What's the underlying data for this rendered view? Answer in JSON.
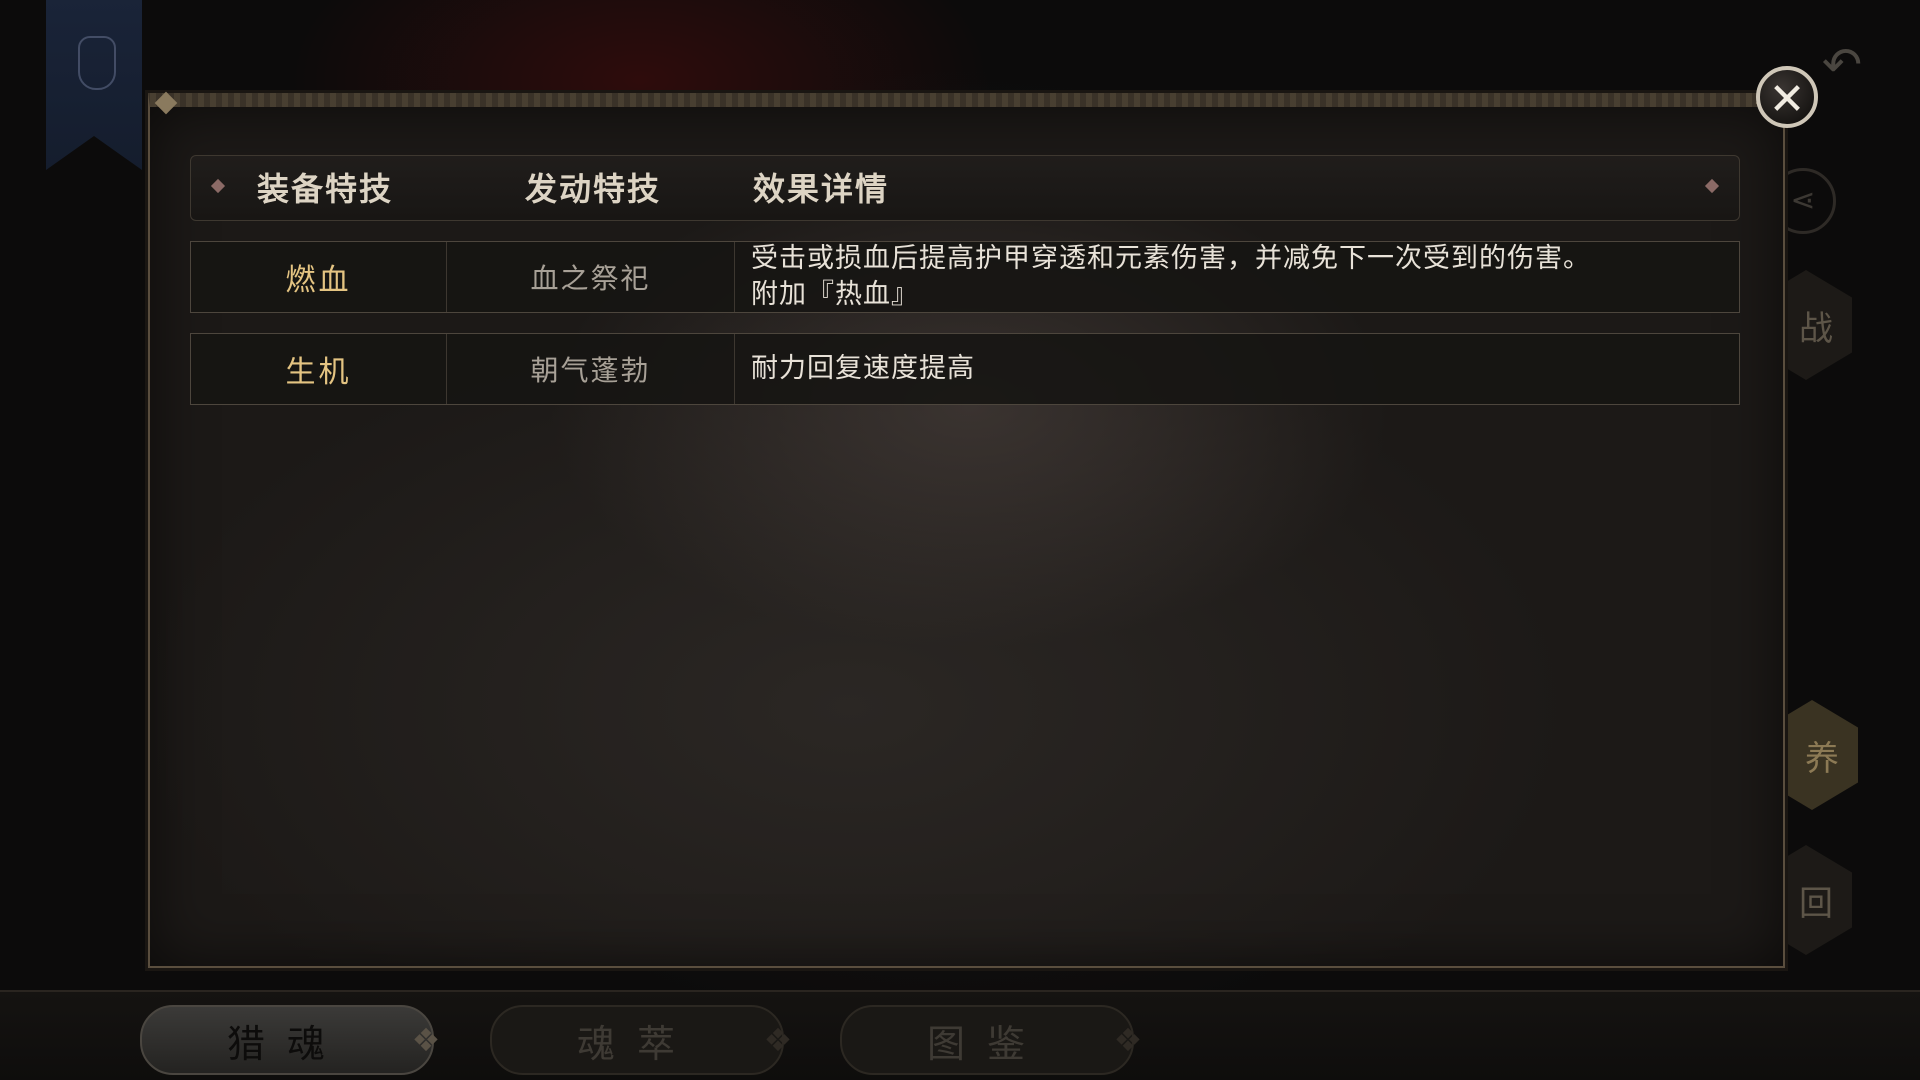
{
  "background": {
    "side_buttons": [
      "战",
      "养",
      "回"
    ],
    "bottom_tabs": [
      {
        "label": "猎魂",
        "active": true
      },
      {
        "label": "魂萃",
        "active": false
      },
      {
        "label": "图鉴",
        "active": false
      }
    ]
  },
  "dialog": {
    "close_icon": "close-icon",
    "headers": {
      "trait": "装备特技",
      "trigger": "发动特技",
      "effect": "效果详情"
    },
    "rows": [
      {
        "trait": "燃血",
        "trigger": "血之祭祀",
        "effect_line1": "受击或损血后提高护甲穿透和元素伤害，并减免下一次受到的伤害。",
        "effect_line2": "附加『热血』"
      },
      {
        "trait": "生机",
        "trigger": "朝气蓬勃",
        "effect_line1": "耐力回复速度提高"
      }
    ]
  },
  "colors": {
    "trait_name": "#e4c482",
    "trigger_name": "#a8a197",
    "effect_text": "#e8e2d8",
    "header_text": "#ddd4c4"
  }
}
